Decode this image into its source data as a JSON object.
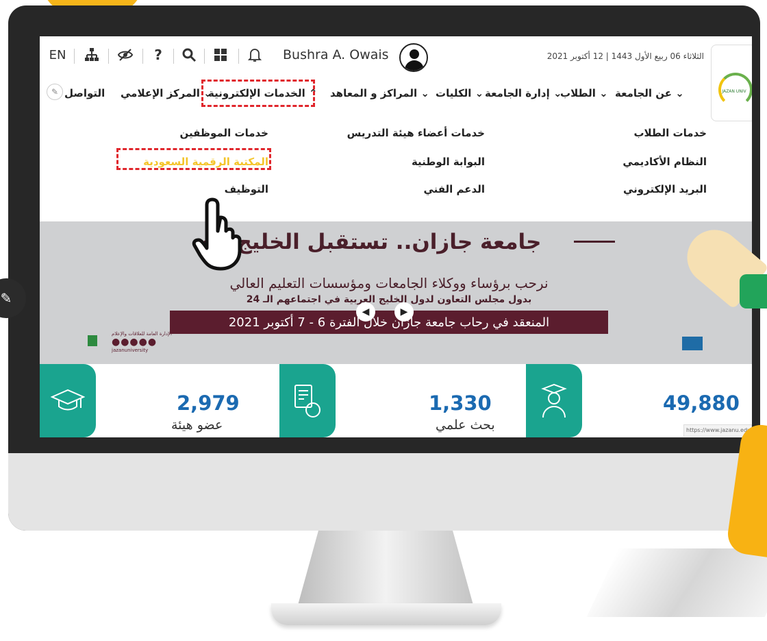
{
  "header": {
    "lang_toggle": "EN",
    "user_name": "Bushra A. Owais",
    "date": "الثلاثاء 06 ربيع الأول 1443 | 12 أكتوبر 2021"
  },
  "nav": {
    "items": [
      "عن الجامعة",
      "الطلاب",
      "إدارة الجامعة",
      "الكليات",
      "المراكز و المعاهد",
      "الخدمات الإلكترونية",
      "المركز الإعلامي",
      "التواصل"
    ]
  },
  "mega_menu": {
    "col1": [
      "خدمات الطلاب",
      "النظام الأكاديمي",
      "البريد الإلكتروني"
    ],
    "col2": [
      "خدمات أعضاء هيئة التدريس",
      "البوابة الوطنية",
      "الدعم الفني"
    ],
    "col3": [
      "خدمات الموظفين",
      "المكتبة الرقمية السعودية",
      "التوظيف"
    ]
  },
  "banner": {
    "title": "جامعة جازان.. تستقبل الخليج",
    "subtitle": "نرحب برؤساء ووكلاء الجامعات ومؤسسات التعليم العالي",
    "subtitle2": "بدول مجلس التعاون لدول الخليج العربية في اجتماعهم الـ 24",
    "strip": "المنعقد في رحاب جامعة جازان خلال الفترة 6 - 7 أكتوبر 2021",
    "logo_caption": "الإدارة العامة للعلاقات والإعلام",
    "logo_site": "jazanuniversity"
  },
  "stats": [
    {
      "value": "2,979",
      "label": "عضو هيئة"
    },
    {
      "value": "1,330",
      "label": "بحث علمي"
    },
    {
      "value": "49,880",
      "label": ""
    }
  ],
  "status_url": "https://www.jazanu.edu.sa"
}
